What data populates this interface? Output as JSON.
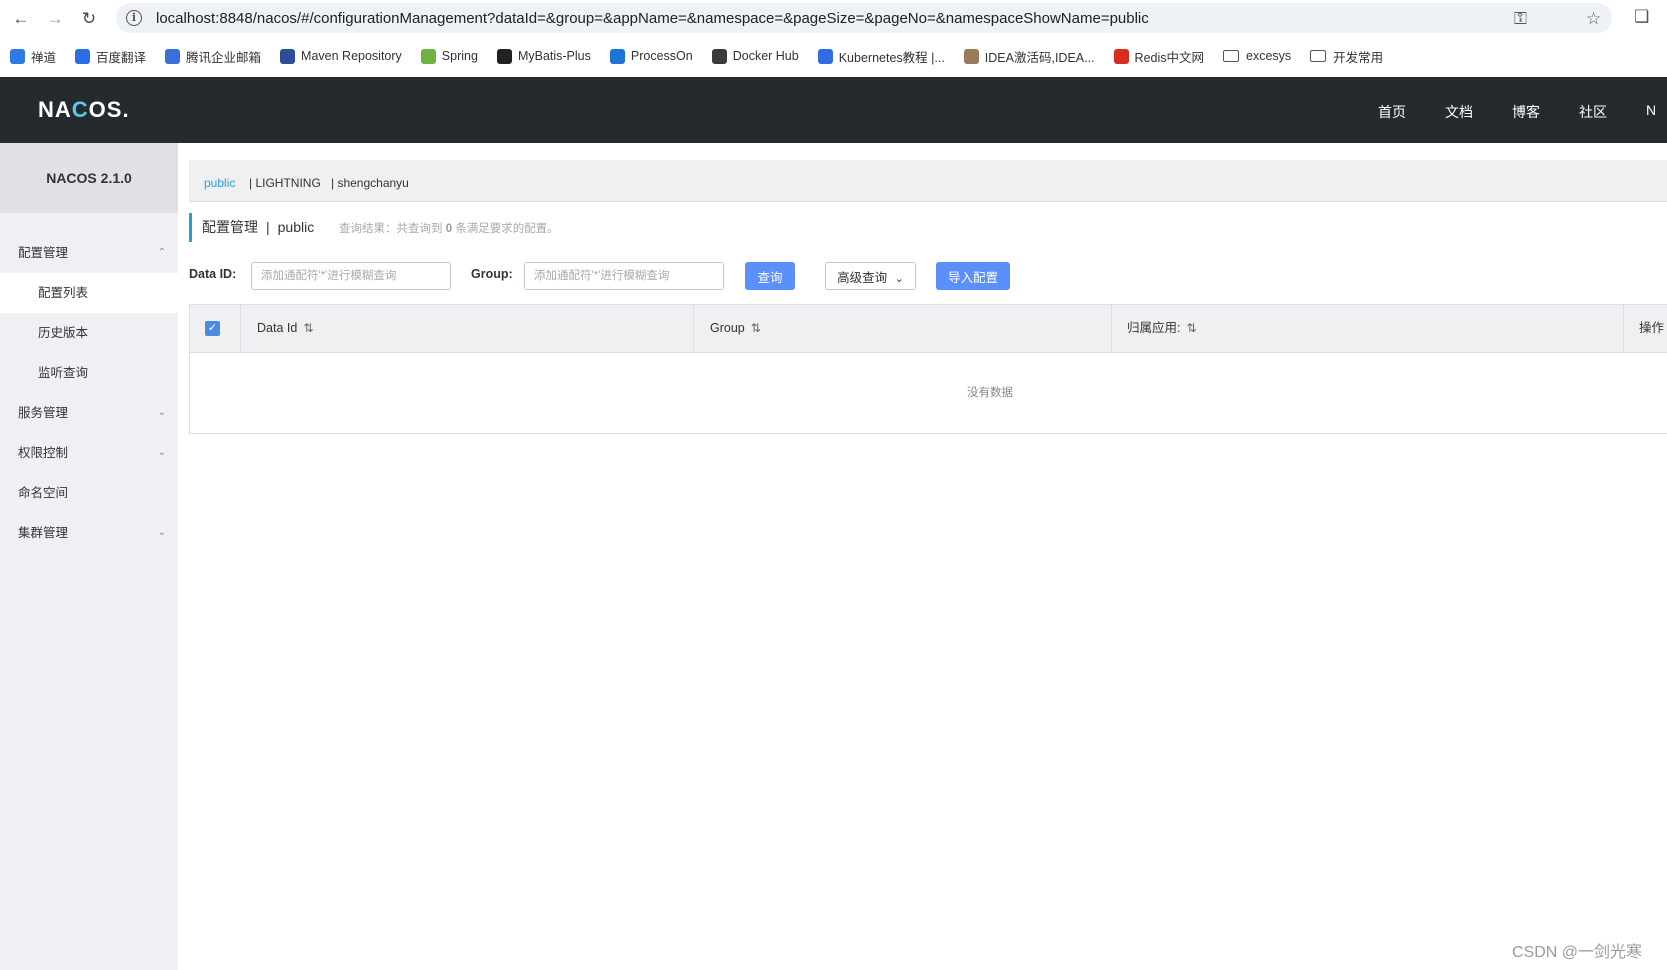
{
  "browser": {
    "url": "localhost:8848/nacos/#/configurationManagement?dataId=&group=&appName=&namespace=&pageSize=&pageNo=&namespaceShowName=public",
    "bookmarks": [
      {
        "label": "禅道",
        "icon": "zentao-icon",
        "color": "#2f7be5"
      },
      {
        "label": "百度翻译",
        "icon": "baidu-translate-icon",
        "color": "#2b6de3"
      },
      {
        "label": "腾讯企业邮箱",
        "icon": "tencent-mail-icon",
        "color": "#3a6fd8"
      },
      {
        "label": "Maven Repository",
        "icon": "maven-icon",
        "color": "#2a4f94"
      },
      {
        "label": "Spring",
        "icon": "spring-icon",
        "color": "#6db33f"
      },
      {
        "label": "MyBatis-Plus",
        "icon": "mybatis-icon",
        "color": "#222222"
      },
      {
        "label": "ProcessOn",
        "icon": "processon-icon",
        "color": "#1e74d6"
      },
      {
        "label": "Docker Hub",
        "icon": "docker-icon",
        "color": "#3a3a3a"
      },
      {
        "label": "Kubernetes教程 |...",
        "icon": "kubernetes-icon",
        "color": "#326ce5"
      },
      {
        "label": "IDEA激活码,IDEA...",
        "icon": "idea-icon",
        "color": "#9a7a5a"
      },
      {
        "label": "Redis中文网",
        "icon": "redis-icon",
        "color": "#d82c20"
      },
      {
        "label": "excesys",
        "icon": "folder-icon",
        "color": "#555555"
      },
      {
        "label": "开发常用",
        "icon": "folder-icon",
        "color": "#555555"
      }
    ]
  },
  "header": {
    "logo": "NACOS.",
    "nav": [
      "首页",
      "文档",
      "博客",
      "社区",
      "N"
    ]
  },
  "sidebar": {
    "title": "NACOS 2.1.0",
    "items": [
      {
        "label": "配置管理",
        "type": "group",
        "caret": "up"
      },
      {
        "label": "配置列表",
        "type": "sub",
        "active": true
      },
      {
        "label": "历史版本",
        "type": "sub"
      },
      {
        "label": "监听查询",
        "type": "sub"
      },
      {
        "label": "服务管理",
        "type": "group",
        "caret": "down"
      },
      {
        "label": "权限控制",
        "type": "group",
        "caret": "down"
      },
      {
        "label": "命名空间",
        "type": "group"
      },
      {
        "label": "集群管理",
        "type": "group",
        "caret": "down"
      }
    ]
  },
  "namespaces": [
    "public",
    "| LIGHTNING",
    "| shengchanyu"
  ],
  "page": {
    "title": "配置管理",
    "separator": "|",
    "namespace": "public",
    "result_prefix": "查询结果：共查询到",
    "result_count": "0",
    "result_suffix": "条满足要求的配置。"
  },
  "search": {
    "dataid_label": "Data ID:",
    "dataid_placeholder": "添加通配符'*'进行模糊查询",
    "group_label": "Group:",
    "group_placeholder": "添加通配符'*'进行模糊查询",
    "query_button": "查询",
    "advanced_button": "高级查询",
    "import_button": "导入配置"
  },
  "table": {
    "columns": [
      "Data Id",
      "Group",
      "归属应用:",
      "操作"
    ],
    "empty_text": "没有数据"
  },
  "watermark": "CSDN @一剑光寒"
}
